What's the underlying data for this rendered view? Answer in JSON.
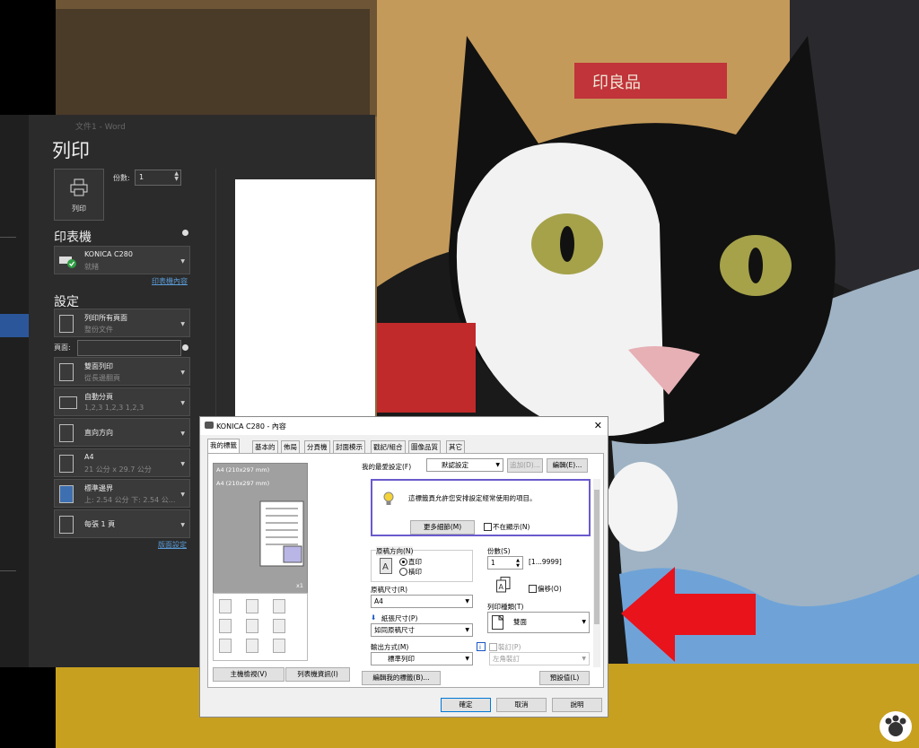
{
  "word": {
    "window_title": "文件1 - Word",
    "heading": "列印",
    "print_button": "列印",
    "copies_label": "份數:",
    "copies_value": "1",
    "printer_heading": "印表機",
    "printer_name": "KONICA C280",
    "printer_status": "就緒",
    "printer_props_link": "印表機內容",
    "settings_heading": "設定",
    "settings": [
      {
        "line1": "列印所有頁面",
        "line2": "整份文件",
        "icon": "pages-icon"
      },
      {
        "line1": "雙面列印",
        "line2": "從長邊翻頁",
        "icon": "duplex-icon"
      },
      {
        "line1": "自動分頁",
        "line2": "1,2,3    1,2,3    1,2,3",
        "icon": "collate-icon"
      },
      {
        "line1": "直向方向",
        "line2": "",
        "icon": "portrait-icon"
      },
      {
        "line1": "A4",
        "line2": "21 公分 x 29.7 公分",
        "icon": "paper-size-icon"
      },
      {
        "line1": "標準邊界",
        "line2": "上: 2.54 公分 下: 2.54 公...",
        "icon": "margins-icon"
      },
      {
        "line1": "每張 1 頁",
        "line2": "",
        "icon": "pages-per-sheet-icon"
      }
    ],
    "pages_label": "頁面:",
    "page_setup_link": "版面設定"
  },
  "dialog": {
    "title": "KONICA C280 - 內容",
    "tabs": [
      "我的標籤",
      "基本的",
      "佈局",
      "分頁機",
      "封面模示",
      "戳記/組合",
      "圖像品質",
      "其它"
    ],
    "active_tab": 0,
    "preview_size_1": "A4 (210x297 mm)",
    "preview_size_2": "A4 (210x297 mm)",
    "preview_zoom": "x1",
    "printer_view_button": "主機檢視(V)",
    "printer_info_button": "列表機資訊(I)",
    "favorite_label": "我的最愛設定(F)",
    "favorite_value": "默認設定",
    "add_button": "追加(D)...",
    "edit_button": "編輯(E)...",
    "info_text": "這標籤頁允許您安排設定經常使用的項目。",
    "more_details_button": "更多細節(M)",
    "dont_show_label": "不在顯示(N)",
    "orientation_label": "原稿方向(N)",
    "orientation_portrait": "直印",
    "orientation_landscape": "橫印",
    "copies_label": "份數(S)",
    "copies_value": "1",
    "copies_range": "[1...9999]",
    "original_size_label": "原稿尺寸(R)",
    "original_size_value": "A4",
    "offset_label": "偏移(O)",
    "paper_size_label": "紙張尺寸(P)",
    "paper_size_value": "如同原稿尺寸",
    "print_type_label": "列印種類(T)",
    "print_type_value": "雙面",
    "output_label": "輸出方式(M)",
    "output_value": "標準列印",
    "binding_label": "裝訂(P)",
    "binding_value": "左角裝訂",
    "edit_tab_button": "編輯我的標籤(B)...",
    "defaults_button": "預設值(L)",
    "ok_button": "確定",
    "cancel_button": "取消",
    "help_button": "說明"
  },
  "photo": {
    "box_print": "印良品"
  },
  "colors": {
    "word_bg": "#2b2b2b",
    "accent": "#2b579a",
    "arrow": "#e8131b",
    "link": "#5b9bd5"
  }
}
